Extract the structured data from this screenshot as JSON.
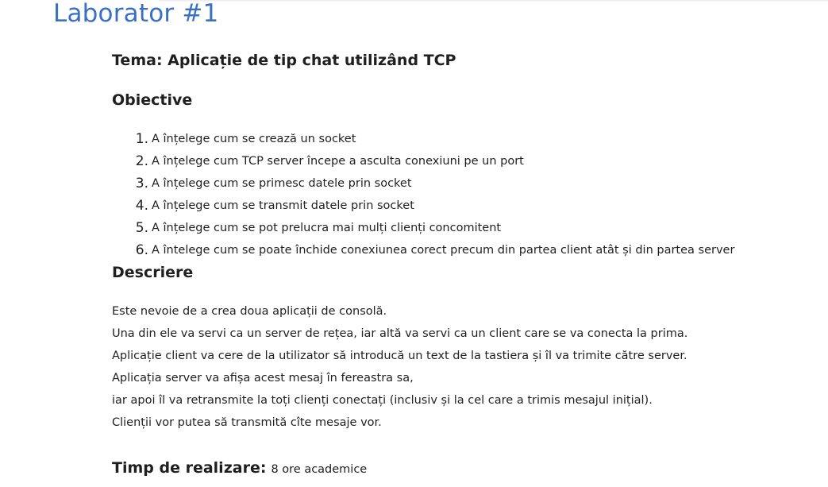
{
  "page_title": "Laborator #1",
  "topic": "Tema: Aplicație de tip chat utilizând TCP",
  "objectives": {
    "heading": "Obiective",
    "items": [
      {
        "num": "1.",
        "text": "A înțelege cum se crează un socket"
      },
      {
        "num": "2.",
        "text": "A înțelege cum TCP server începe a asculta conexiuni pe un port"
      },
      {
        "num": "3.",
        "text": "A înțelege cum se primesc datele prin socket"
      },
      {
        "num": "4.",
        "text": "A înțelege cum se transmit datele prin socket"
      },
      {
        "num": "5.",
        "text": "A înțelege cum se pot prelucra mai mulți clienți concomitent"
      },
      {
        "num": "6.",
        "text": "A întelege cum se poate închide conexiunea corect precum din partea client atât și din partea server"
      }
    ]
  },
  "description": {
    "heading": "Descriere",
    "lines": [
      "Este nevoie de a crea doua aplicații de consolă.",
      "Una din ele va servi ca un server de rețea, iar altă va servi ca un client care se va conecta la prima.",
      "Aplicație client va cere de la utilizator să introducă un text de la tastiera și îl va trimite către server.",
      "Aplicația server va afișa acest mesaj în fereastra sa,",
      "iar apoi îl va retransmite la toți clienți conectați (inclusiv și la cel care a trimis mesajul inițial).",
      "Clienții vor putea să transmită cîte mesaje vor."
    ]
  },
  "time": {
    "label": "Timp de realizare:",
    "value": "8 ore academice"
  },
  "colors": {
    "title": "#3a6fc4",
    "text": "#1f1f1f",
    "background": "#ffffff"
  }
}
